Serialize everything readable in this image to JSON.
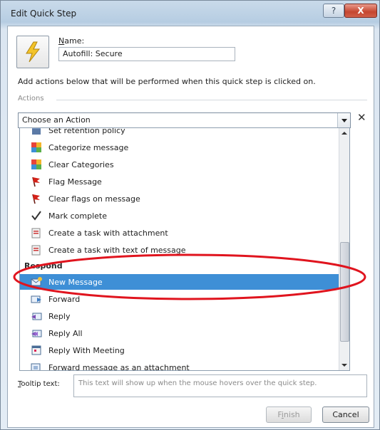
{
  "window": {
    "title": "Edit Quick Step",
    "help_label": "?",
    "close_label": "X"
  },
  "name": {
    "label_access": "N",
    "label_rest": "ame:",
    "value": "Autofill: Secure"
  },
  "description": "Add actions below that will be performed when this quick step is clicked on.",
  "actions_label": "Actions",
  "action_combo": {
    "value": "Choose an Action"
  },
  "remove_action_label": "✕",
  "dropdown": {
    "items": [
      {
        "label": "Set retention policy",
        "icon": "retention-policy-icon"
      },
      {
        "label": "Categorize message",
        "icon": "categorize-icon"
      },
      {
        "label": "Clear Categories",
        "icon": "clear-categories-icon"
      },
      {
        "label": "Flag Message",
        "icon": "flag-icon"
      },
      {
        "label": "Clear flags on message",
        "icon": "clear-flag-icon"
      },
      {
        "label": "Mark complete",
        "icon": "checkmark-icon"
      },
      {
        "label": "Create a task with attachment",
        "icon": "task-attachment-icon"
      },
      {
        "label": "Create a task with text of message",
        "icon": "task-text-icon"
      }
    ],
    "group_header": "Respond",
    "respond_items": [
      {
        "label": "New Message",
        "icon": "new-message-icon",
        "selected": true
      },
      {
        "label": "Forward",
        "icon": "forward-icon"
      },
      {
        "label": "Reply",
        "icon": "reply-icon"
      },
      {
        "label": "Reply All",
        "icon": "reply-all-icon"
      },
      {
        "label": "Reply With Meeting",
        "icon": "reply-meeting-icon"
      },
      {
        "label": "Forward message as an attachment",
        "icon": "forward-attachment-icon"
      }
    ]
  },
  "tooltip": {
    "label_access": "T",
    "label_rest": "ooltip text:",
    "placeholder": "This text will show up when the mouse hovers over the quick step."
  },
  "buttons": {
    "finish_access": "i",
    "finish_pre": "F",
    "finish_post": "nish",
    "cancel": "Cancel"
  },
  "colors": {
    "selection": "#3e8fd6",
    "annotation_ellipse": "#e0141e"
  }
}
